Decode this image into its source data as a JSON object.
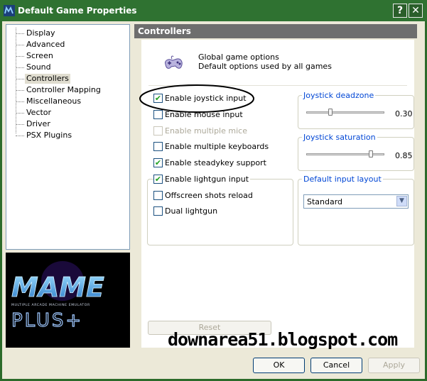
{
  "window": {
    "title": "Default Game Properties",
    "help_button": "?",
    "close_button": "✕"
  },
  "tree": {
    "items": [
      "Display",
      "Advanced",
      "Screen",
      "Sound",
      "Controllers",
      "Controller Mapping",
      "Miscellaneous",
      "Vector",
      "Driver",
      "PSX Plugins"
    ],
    "selected": "Controllers"
  },
  "logo": {
    "wordmark": "MAME",
    "tagline": "MULTIPLE ARCADE MACHINE EMULATOR",
    "plus": "PLUS+"
  },
  "panel": {
    "header": "Controllers",
    "intro_line1": "Global game options",
    "intro_line2": "Default options used by all games",
    "checkboxes": [
      {
        "label": "Enable joystick input",
        "checked": true,
        "enabled": true
      },
      {
        "label": "Enable mouse input",
        "checked": false,
        "enabled": true
      },
      {
        "label": "Enable multiple mice",
        "checked": false,
        "enabled": false
      },
      {
        "label": "Enable multiple keyboards",
        "checked": false,
        "enabled": true
      },
      {
        "label": "Enable steadykey support",
        "checked": true,
        "enabled": true
      },
      {
        "label": "Enable lightgun input",
        "checked": true,
        "enabled": true
      },
      {
        "label": "Offscreen shots reload",
        "checked": false,
        "enabled": true
      },
      {
        "label": "Dual lightgun",
        "checked": false,
        "enabled": true
      }
    ],
    "deadzone": {
      "label": "Joystick deadzone",
      "value": "0.30",
      "fraction": 0.3
    },
    "saturation": {
      "label": "Joystick saturation",
      "value": "0.85",
      "fraction": 0.85
    },
    "input_layout": {
      "label": "Default input layout",
      "selected": "Standard"
    },
    "reset_button": "Reset"
  },
  "footer": {
    "ok": "OK",
    "cancel": "Cancel",
    "apply": "Apply"
  },
  "watermark": "downarea51.blogspot.com",
  "colors": {
    "titlebar": "#2f7231",
    "panel_header": "#6e6e6e",
    "group_label": "#0046d5",
    "check": "#21a121",
    "annotation_circle": "#000000"
  }
}
